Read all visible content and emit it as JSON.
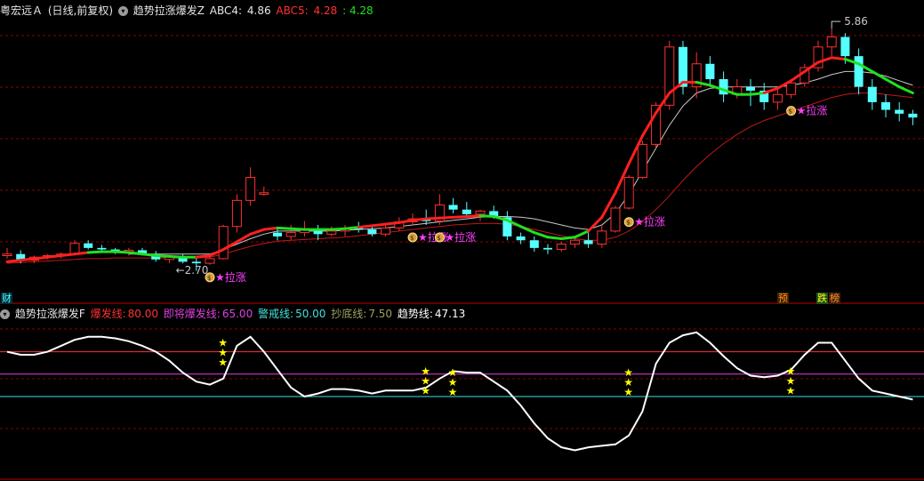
{
  "top_header": {
    "stock": "粤宏远Ａ",
    "period": "(日线,前复权)",
    "indicator": "趋势拉涨爆发Z",
    "abc4_label": "ABC4:",
    "abc4_value": "4.86",
    "abc5_label": "ABC5:",
    "abc5_value": "4.28",
    "extra_value": ": 4.28"
  },
  "bottom_header": {
    "indicator": "趋势拉涨爆发F",
    "items": [
      {
        "label": "爆发线:",
        "value": "80.00",
        "color": "#ff3030"
      },
      {
        "label": "即将爆发线:",
        "value": "65.00",
        "color": "#e040e0"
      },
      {
        "label": "警戒线:",
        "value": "50.00",
        "color": "#40e0e0"
      },
      {
        "label": "抄底线:",
        "value": "7.50",
        "color": "#a0a060"
      },
      {
        "label": "趋势线:",
        "value": "47.13",
        "color": "#ffffff"
      }
    ]
  },
  "left_tag": "财",
  "bottom_tags": [
    {
      "text": "预",
      "color": "#ff9020",
      "bg": "#402000"
    },
    {
      "text": "跌",
      "color": "#ffff00",
      "bg": "#205020"
    },
    {
      "text": "榜",
      "color": "#ff9020",
      "bg": "#402010"
    }
  ],
  "annotations": {
    "high": "5.86",
    "low": "2.70",
    "lazhang": "拉涨"
  },
  "colors": {
    "up": "#ff3030",
    "down": "#54ffff",
    "trend_red": "#ff2020",
    "trend_green": "#20e020",
    "ma_white": "#c8c8c8",
    "ma_red": "#c01818",
    "star": "#ffff00",
    "grid": "#8b0000"
  },
  "chart_data": [
    {
      "type": "candlestick",
      "ylim": [
        2.5,
        6.0
      ],
      "ohlc": [
        [
          2.9,
          3.0,
          2.86,
          2.92
        ],
        [
          2.92,
          2.97,
          2.8,
          2.84
        ],
        [
          2.84,
          2.9,
          2.8,
          2.88
        ],
        [
          2.88,
          2.92,
          2.85,
          2.9
        ],
        [
          2.9,
          2.94,
          2.86,
          2.92
        ],
        [
          2.92,
          3.1,
          2.9,
          3.06
        ],
        [
          3.06,
          3.1,
          2.98,
          3.0
        ],
        [
          3.0,
          3.04,
          2.95,
          2.98
        ],
        [
          2.98,
          3.0,
          2.92,
          2.95
        ],
        [
          2.95,
          3.0,
          2.9,
          2.97
        ],
        [
          2.97,
          3.0,
          2.9,
          2.92
        ],
        [
          2.92,
          2.96,
          2.82,
          2.85
        ],
        [
          2.85,
          2.92,
          2.8,
          2.88
        ],
        [
          2.88,
          2.92,
          2.8,
          2.82
        ],
        [
          2.82,
          2.88,
          2.7,
          2.8
        ],
        [
          2.8,
          2.9,
          2.78,
          2.86
        ],
        [
          2.86,
          3.3,
          2.85,
          3.28
        ],
        [
          3.28,
          3.7,
          3.2,
          3.62
        ],
        [
          3.62,
          4.05,
          3.55,
          3.92
        ],
        [
          3.7,
          3.8,
          3.68,
          3.72
        ],
        [
          3.2,
          3.25,
          3.1,
          3.15
        ],
        [
          3.15,
          3.3,
          3.1,
          3.2
        ],
        [
          3.2,
          3.35,
          3.15,
          3.25
        ],
        [
          3.25,
          3.3,
          3.1,
          3.18
        ],
        [
          3.18,
          3.28,
          3.15,
          3.22
        ],
        [
          3.22,
          3.3,
          3.15,
          3.26
        ],
        [
          3.26,
          3.34,
          3.2,
          3.24
        ],
        [
          3.24,
          3.3,
          3.15,
          3.18
        ],
        [
          3.18,
          3.3,
          3.15,
          3.26
        ],
        [
          3.26,
          3.4,
          3.22,
          3.34
        ],
        [
          3.34,
          3.45,
          3.3,
          3.38
        ],
        [
          3.38,
          3.5,
          3.3,
          3.35
        ],
        [
          3.35,
          3.7,
          3.3,
          3.56
        ],
        [
          3.56,
          3.65,
          3.45,
          3.5
        ],
        [
          3.5,
          3.6,
          3.4,
          3.44
        ],
        [
          3.44,
          3.5,
          3.35,
          3.48
        ],
        [
          3.48,
          3.55,
          3.38,
          3.4
        ],
        [
          3.4,
          3.48,
          3.1,
          3.15
        ],
        [
          3.15,
          3.2,
          3.05,
          3.1
        ],
        [
          3.1,
          3.15,
          2.95,
          3.0
        ],
        [
          3.0,
          3.05,
          2.92,
          2.98
        ],
        [
          2.98,
          3.08,
          2.95,
          3.05
        ],
        [
          3.05,
          3.12,
          3.0,
          3.1
        ],
        [
          3.1,
          3.2,
          3.0,
          3.05
        ],
        [
          3.05,
          3.3,
          3.0,
          3.22
        ],
        [
          3.22,
          3.55,
          3.2,
          3.52
        ],
        [
          3.52,
          3.95,
          3.5,
          3.92
        ],
        [
          3.92,
          4.4,
          3.9,
          4.35
        ],
        [
          4.35,
          4.9,
          4.3,
          4.86
        ],
        [
          4.86,
          5.7,
          4.8,
          5.62
        ],
        [
          5.62,
          5.7,
          5.0,
          5.1
        ],
        [
          5.1,
          5.55,
          4.95,
          5.4
        ],
        [
          5.4,
          5.5,
          5.1,
          5.2
        ],
        [
          5.2,
          5.3,
          4.9,
          5.0
        ],
        [
          5.0,
          5.2,
          4.95,
          5.1
        ],
        [
          5.1,
          5.2,
          4.85,
          5.05
        ],
        [
          5.05,
          5.15,
          4.8,
          4.9
        ],
        [
          4.9,
          5.1,
          4.8,
          5.0
        ],
        [
          5.0,
          5.2,
          4.95,
          5.15
        ],
        [
          5.15,
          5.4,
          5.1,
          5.35
        ],
        [
          5.35,
          5.7,
          5.3,
          5.62
        ],
        [
          5.62,
          5.86,
          5.5,
          5.75
        ],
        [
          5.75,
          5.8,
          5.4,
          5.5
        ],
        [
          5.5,
          5.6,
          5.0,
          5.1
        ],
        [
          5.1,
          5.2,
          4.8,
          4.9
        ],
        [
          4.9,
          5.0,
          4.7,
          4.8
        ],
        [
          4.8,
          4.9,
          4.65,
          4.75
        ],
        [
          4.75,
          4.8,
          4.6,
          4.7
        ]
      ],
      "trend_line": [
        2.82,
        2.84,
        2.86,
        2.88,
        2.9,
        2.92,
        2.94,
        2.95,
        2.95,
        2.94,
        2.92,
        2.9,
        2.89,
        2.88,
        2.88,
        2.9,
        2.98,
        3.08,
        3.18,
        3.24,
        3.26,
        3.25,
        3.24,
        3.24,
        3.24,
        3.25,
        3.27,
        3.29,
        3.31,
        3.33,
        3.36,
        3.38,
        3.39,
        3.4,
        3.41,
        3.42,
        3.41,
        3.36,
        3.28,
        3.2,
        3.14,
        3.12,
        3.14,
        3.22,
        3.4,
        3.72,
        4.1,
        4.46,
        4.76,
        5.02,
        5.16,
        5.16,
        5.12,
        5.06,
        5.0,
        5.0,
        5.02,
        5.08,
        5.18,
        5.3,
        5.42,
        5.48,
        5.46,
        5.4,
        5.3,
        5.2,
        5.1,
        5.02
      ],
      "trend_state": [
        "r",
        "r",
        "r",
        "r",
        "r",
        "r",
        "g",
        "g",
        "g",
        "g",
        "g",
        "g",
        "g",
        "g",
        "r",
        "r",
        "r",
        "r",
        "r",
        "r",
        "g",
        "g",
        "g",
        "g",
        "g",
        "g",
        "r",
        "r",
        "r",
        "r",
        "r",
        "r",
        "r",
        "r",
        "r",
        "g",
        "g",
        "g",
        "g",
        "g",
        "g",
        "g",
        "g",
        "r",
        "r",
        "r",
        "r",
        "r",
        "r",
        "r",
        "r",
        "g",
        "g",
        "g",
        "g",
        "g",
        "r",
        "r",
        "r",
        "r",
        "r",
        "r",
        "g",
        "g",
        "g",
        "g",
        "g",
        "g"
      ],
      "ma_white": [
        null,
        null,
        null,
        null,
        null,
        null,
        null,
        null,
        null,
        2.92,
        2.92,
        2.92,
        2.92,
        2.92,
        2.92,
        2.92,
        2.98,
        3.05,
        3.12,
        3.18,
        3.22,
        3.22,
        3.22,
        3.22,
        3.22,
        3.23,
        3.24,
        3.25,
        3.26,
        3.28,
        3.3,
        3.32,
        3.34,
        3.36,
        3.38,
        3.4,
        3.41,
        3.41,
        3.4,
        3.38,
        3.34,
        3.3,
        3.26,
        3.24,
        3.3,
        3.45,
        3.7,
        4.0,
        4.3,
        4.6,
        4.85,
        5.02,
        5.08,
        5.1,
        5.1,
        5.1,
        5.1,
        5.1,
        5.12,
        5.15,
        5.2,
        5.26,
        5.3,
        5.3,
        5.28,
        5.24,
        5.18,
        5.12
      ],
      "ma_red": [
        2.8,
        2.81,
        2.82,
        2.83,
        2.84,
        2.85,
        2.86,
        2.86,
        2.87,
        2.87,
        2.87,
        2.87,
        2.87,
        2.87,
        2.87,
        2.88,
        2.92,
        2.97,
        3.02,
        3.06,
        3.09,
        3.1,
        3.11,
        3.12,
        3.13,
        3.14,
        3.16,
        3.18,
        3.2,
        3.22,
        3.24,
        3.26,
        3.28,
        3.3,
        3.31,
        3.32,
        3.32,
        3.31,
        3.28,
        3.24,
        3.2,
        3.16,
        3.12,
        3.1,
        3.1,
        3.14,
        3.22,
        3.34,
        3.5,
        3.68,
        3.88,
        4.06,
        4.22,
        4.36,
        4.48,
        4.58,
        4.66,
        4.72,
        4.78,
        4.84,
        4.9,
        4.96,
        5.0,
        5.02,
        5.02,
        5.0,
        4.98,
        4.96
      ],
      "signals_lazhang": [
        15,
        30,
        32,
        46,
        58
      ],
      "high_marker_index": 61,
      "low_marker_index": 13
    },
    {
      "type": "line",
      "ylim": [
        0,
        100
      ],
      "levels": [
        80,
        65,
        50
      ],
      "trend": [
        80,
        78,
        78,
        80,
        84,
        88,
        90,
        90,
        89,
        87,
        84,
        80,
        74,
        66,
        60,
        58,
        62,
        84,
        90,
        80,
        68,
        56,
        50,
        52,
        55,
        55,
        54,
        52,
        54,
        54,
        54,
        56,
        62,
        67,
        66,
        66,
        60,
        54,
        44,
        32,
        22,
        16,
        14,
        16,
        17,
        18,
        24,
        40,
        72,
        86,
        91,
        93,
        86,
        77,
        69,
        64,
        63,
        64,
        68,
        78,
        86,
        86,
        74,
        62,
        54,
        52,
        50,
        48
      ],
      "stars_index": [
        16,
        31,
        33,
        46,
        58
      ],
      "stars_value": [
        86,
        67,
        66,
        66,
        67
      ]
    }
  ]
}
